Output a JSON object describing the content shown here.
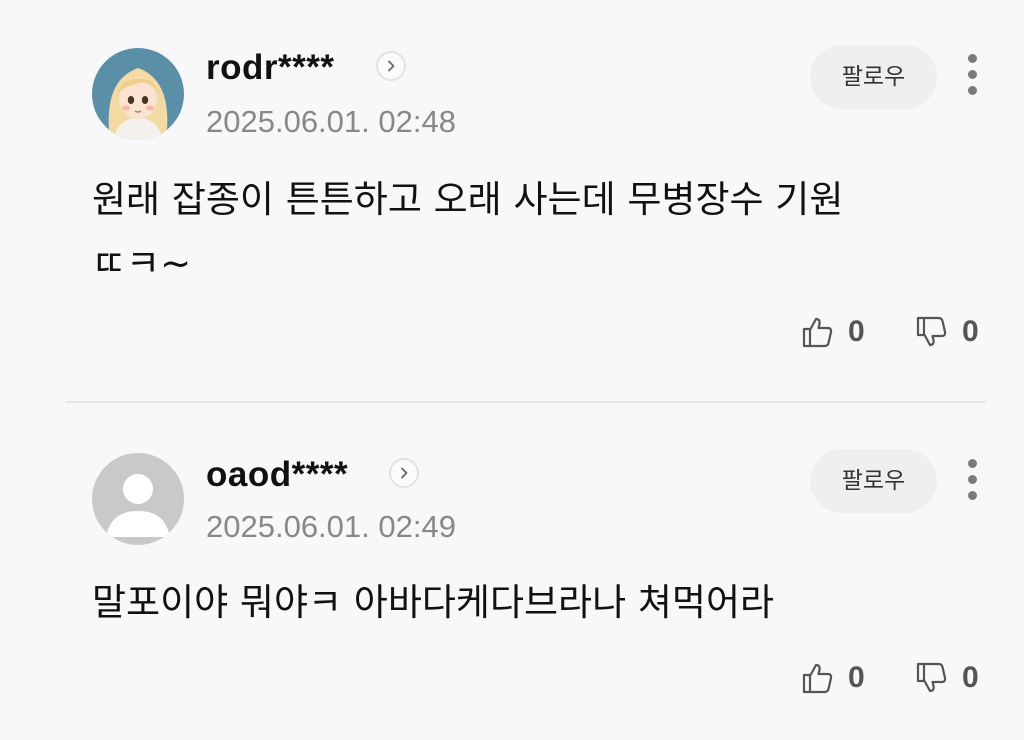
{
  "comments": [
    {
      "username": "rodr****",
      "timestamp": "2025.06.01. 02:48",
      "text": "원래 잡종이 튼튼하고 오래 사는데 무병장수 기원\nㄸㅋ~",
      "follow_label": "팔로우",
      "likes": "0",
      "dislikes": "0",
      "avatar": "illustrated-girl-avatar"
    },
    {
      "username": "oaod****",
      "timestamp": "2025.06.01. 02:49",
      "text": "말포이야 뭐야ㅋ 아바다케다브라나 쳐먹어라",
      "follow_label": "팔로우",
      "likes": "0",
      "dislikes": "0",
      "avatar": "default-person-avatar"
    }
  ],
  "colors": {
    "background": "#f8f8fa",
    "follow_bg": "#efeff2",
    "meta_gray": "#888888",
    "divider": "#e6e6e9"
  }
}
